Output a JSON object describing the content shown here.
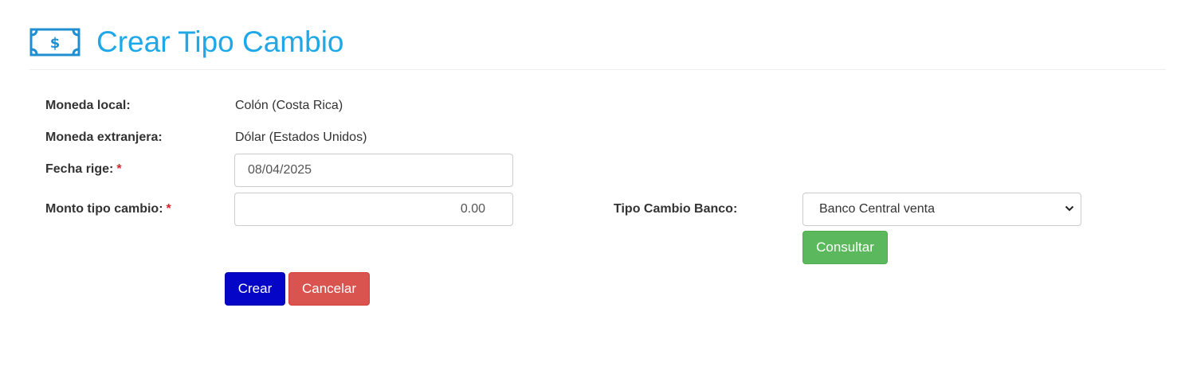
{
  "header": {
    "title": "Crear Tipo Cambio",
    "icon": "money-bill-icon",
    "accent_color": "#1fa8e8"
  },
  "form": {
    "moneda_local": {
      "label": "Moneda local:",
      "value": "Colón (Costa Rica)"
    },
    "moneda_extranjera": {
      "label": "Moneda extranjera:",
      "value": "Dólar (Estados Unidos)"
    },
    "fecha_rige": {
      "label": "Fecha rige:",
      "required_mark": "*",
      "value": "08/04/2025"
    },
    "monto_tipo_cambio": {
      "label": "Monto tipo cambio:",
      "required_mark": "*",
      "value": "0.00"
    },
    "tipo_cambio_banco": {
      "label": "Tipo Cambio Banco:",
      "selected": "Banco Central venta"
    }
  },
  "buttons": {
    "consultar": {
      "label": "Consultar",
      "color": "#5cb85c"
    },
    "crear": {
      "label": "Crear",
      "color": "#0505c8"
    },
    "cancelar": {
      "label": "Cancelar",
      "color": "#d9534f"
    }
  }
}
